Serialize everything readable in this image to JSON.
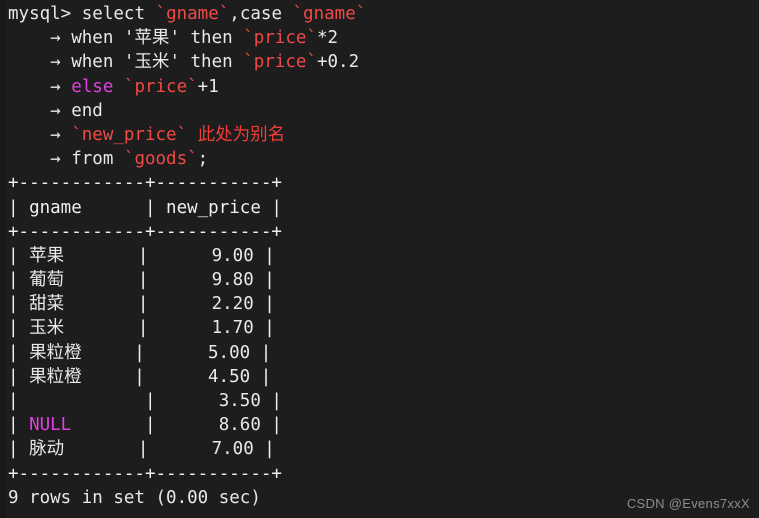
{
  "terminal": {
    "prompt": "mysql> ",
    "continuation": "    → ",
    "query_lines": [
      {
        "prompt": "mysql> ",
        "segments": [
          {
            "text": "select ",
            "style": "plain"
          },
          {
            "text": "`gname`",
            "style": "ident"
          },
          {
            "text": ",case ",
            "style": "plain"
          },
          {
            "text": "`gname`",
            "style": "ident"
          }
        ]
      },
      {
        "prompt": "    → ",
        "segments": [
          {
            "text": "when '苹果' then ",
            "style": "plain"
          },
          {
            "text": "`price`",
            "style": "ident"
          },
          {
            "text": "*2",
            "style": "plain"
          }
        ]
      },
      {
        "prompt": "    → ",
        "segments": [
          {
            "text": "when '玉米' then ",
            "style": "plain"
          },
          {
            "text": "`price`",
            "style": "ident"
          },
          {
            "text": "+0.2",
            "style": "plain"
          }
        ]
      },
      {
        "prompt": "    → ",
        "segments": [
          {
            "text": "else ",
            "style": "kw"
          },
          {
            "text": "`price`",
            "style": "ident"
          },
          {
            "text": "+1",
            "style": "plain"
          }
        ]
      },
      {
        "prompt": "    → ",
        "segments": [
          {
            "text": "end",
            "style": "plain"
          }
        ]
      },
      {
        "prompt": "    → ",
        "segments": [
          {
            "text": "`new_price`",
            "style": "ident"
          },
          {
            "text": " ",
            "style": "plain"
          },
          {
            "text": "此处为别名",
            "style": "note"
          }
        ]
      },
      {
        "prompt": "    → ",
        "segments": [
          {
            "text": "from ",
            "style": "plain"
          },
          {
            "text": "`goods`",
            "style": "ident"
          },
          {
            "text": ";",
            "style": "plain"
          }
        ]
      }
    ],
    "result_table": {
      "separator": "+------------+-----------+",
      "columns": [
        "gname",
        "new_price"
      ],
      "header_row": "| gname      | new_price |",
      "rows": [
        {
          "gname": "苹果",
          "gname_style": "plain",
          "new_price": "9.00"
        },
        {
          "gname": "葡萄",
          "gname_style": "plain",
          "new_price": "9.80"
        },
        {
          "gname": "甜菜",
          "gname_style": "plain",
          "new_price": "2.20"
        },
        {
          "gname": "玉米",
          "gname_style": "plain",
          "new_price": "1.70"
        },
        {
          "gname": "果粒橙",
          "gname_style": "plain",
          "new_price": "5.00"
        },
        {
          "gname": "果粒橙",
          "gname_style": "plain",
          "new_price": "4.50"
        },
        {
          "gname": "",
          "gname_style": "plain",
          "new_price": "3.50"
        },
        {
          "gname": "NULL",
          "gname_style": "kw",
          "new_price": "8.60"
        },
        {
          "gname": "脉动",
          "gname_style": "plain",
          "new_price": "7.00"
        }
      ]
    },
    "status_line": "9 rows in set (0.00 sec)",
    "watermark": "CSDN @Evens7xxX"
  },
  "colors": {
    "background": "#1d1d1d",
    "foreground": "#e8e8e8",
    "identifier_red": "#f04a46",
    "keyword_magenta": "#e040e0",
    "annotation_red": "#f23c36",
    "watermark_gray": "#8d8d8d"
  }
}
